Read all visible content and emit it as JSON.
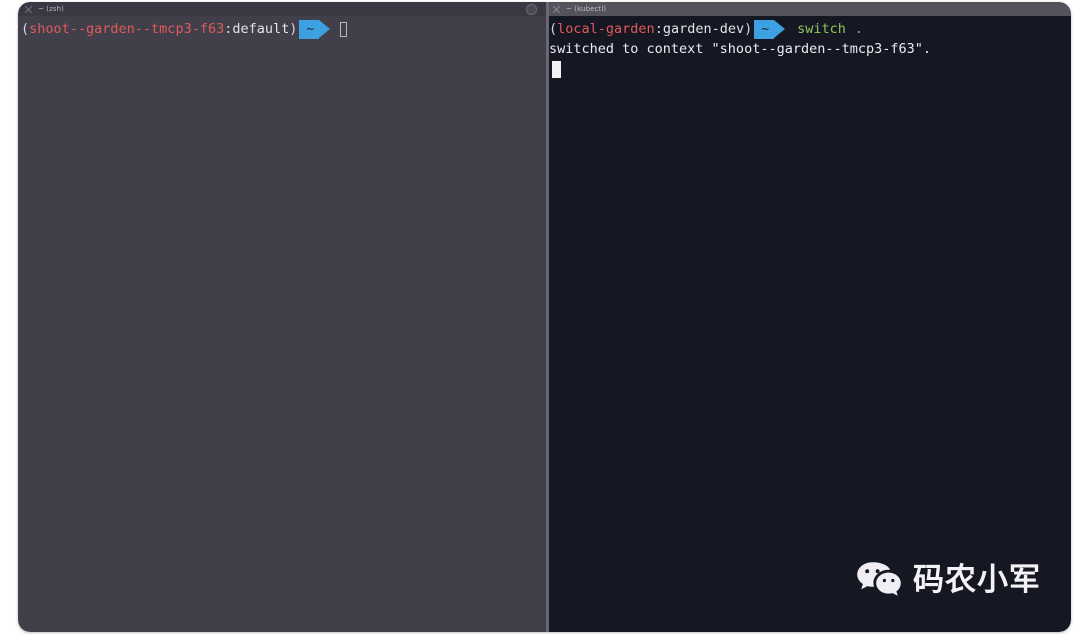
{
  "window": {
    "left_pane": {
      "tab": {
        "title": "~ (zsh)",
        "close_icon": "close-icon",
        "status_icon": "circle-indicator-icon"
      },
      "prompt": {
        "open_paren": "(",
        "context": "shoot--garden--tmcp3-f63",
        "colon": ":",
        "namespace": "default",
        "close_paren": ")",
        "segment_label": "~"
      },
      "cursor": "hollow-block"
    },
    "right_pane": {
      "tab": {
        "title": "~ (kubectl)",
        "close_icon": "close-icon"
      },
      "prompt": {
        "open_paren": "(",
        "context": "local-garden",
        "colon": ":",
        "namespace": "garden-dev",
        "close_paren": ")",
        "segment_label": "~"
      },
      "command": {
        "name": "switch",
        "argument": "."
      },
      "output_lines": [
        "switched to context \"shoot--garden--tmcp3-f63\"."
      ],
      "cursor": "solid-block"
    }
  },
  "watermark": {
    "icon": "wechat-icon",
    "text": "码农小军"
  },
  "colors": {
    "left_pane_bg": "#413f4a",
    "right_pane_bg": "#151823",
    "accent_blue": "#3da0e0",
    "context_red": "#e05a5a",
    "command_green": "#8fc55a",
    "text_light": "#eceaf0"
  }
}
